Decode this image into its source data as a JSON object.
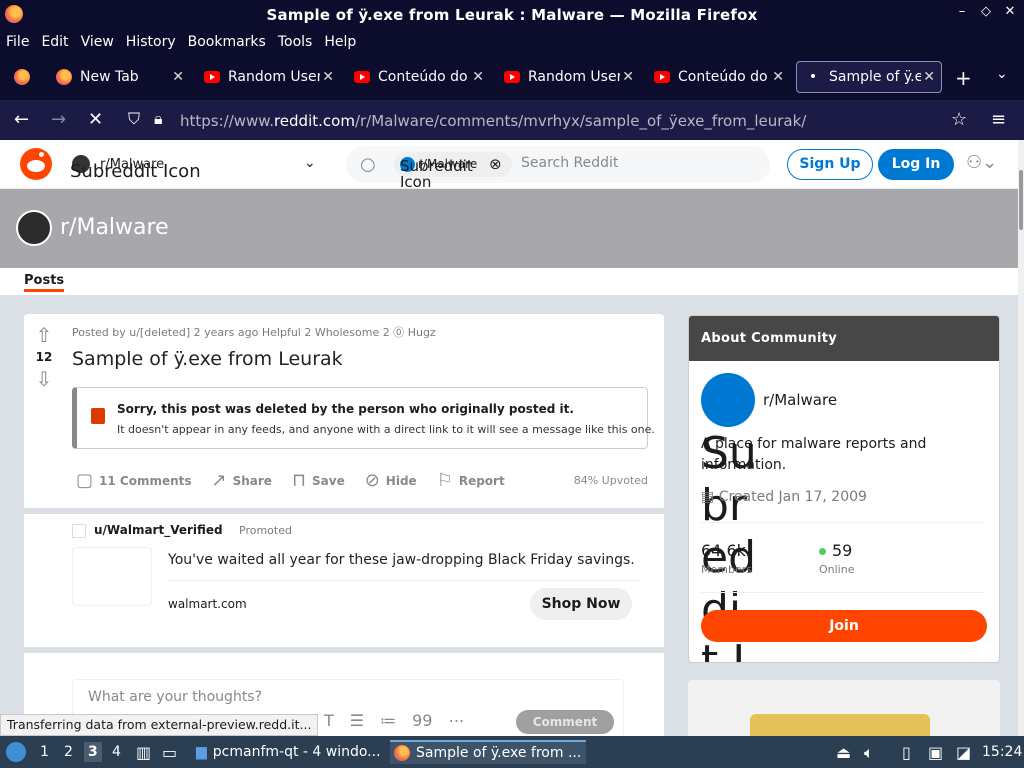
{
  "window": {
    "title": "Sample of ÿ.exe from Leurak : Malware — Mozilla Firefox",
    "controls": [
      "–",
      "◇",
      "✕"
    ]
  },
  "menu": [
    "File",
    "Edit",
    "View",
    "History",
    "Bookmarks",
    "Tools",
    "Help"
  ],
  "tabs": [
    {
      "label": "New Tab",
      "icon": "firefox-icon",
      "active": false
    },
    {
      "label": "Random User",
      "icon": "youtube-icon",
      "active": false
    },
    {
      "label": "Conteúdo do",
      "icon": "youtube-icon",
      "active": false
    },
    {
      "label": "Random User",
      "icon": "youtube-icon",
      "active": false
    },
    {
      "label": "Conteúdo do",
      "icon": "youtube-icon",
      "active": false
    },
    {
      "label": "Sample of ÿ.exe",
      "icon": "loading-dot-icon",
      "active": true
    }
  ],
  "url": {
    "prefix": "https://www.",
    "domain": "reddit.com",
    "path": "/r/Malware/comments/mvrhyx/sample_of_ÿexe_from_leurak/"
  },
  "reddit_header": {
    "community": "r/Malware",
    "community_icon_alt": "Subreddit Icon",
    "search_chip": "r/Malware",
    "search_chip_icon_alt": "Subreddit Icon",
    "search_placeholder": "Search Reddit",
    "signup": "Sign Up",
    "login": "Log In"
  },
  "banner": {
    "name": "r/Malware",
    "tab": "Posts"
  },
  "post": {
    "votes": "12",
    "meta_posted": "Posted by u/[deleted] 2 years ago",
    "award_helpful": "Helpful 2",
    "award_wholesome": "Wholesome 2",
    "award_hugz": "Hugz",
    "title": "Sample of ÿ.exe from Leurak",
    "deleted_title": "Sorry, this post was deleted by the person who originally posted it.",
    "deleted_body": "It doesn't appear in any feeds, and anyone with a direct link to it will see a message like this one.",
    "actions": {
      "comments": "11 Comments",
      "share": "Share",
      "save": "Save",
      "hide": "Hide",
      "report": "Report"
    },
    "upvoted": "84% Upvoted"
  },
  "promoted": {
    "user": "u/Walmart_Verified",
    "tag": "Promoted",
    "text": "You've waited all year for these jaw-dropping Black Friday savings.",
    "domain": "walmart.com",
    "cta": "Shop Now"
  },
  "comment_box": {
    "placeholder": "What are your thoughts?",
    "button": "Comment"
  },
  "status_bar": "Transferring data from external-preview.redd.it...",
  "about": {
    "header": "About Community",
    "name": "r/Malware",
    "icon_alt": "Subreddit Icon",
    "description": "A place for malware reports and information.",
    "created": "Created Jan 17, 2009",
    "members": "64.6k",
    "members_label": "Members",
    "online": "59",
    "online_label": "Online",
    "join": "Join"
  },
  "taskbar": {
    "workspaces": [
      "1",
      "2",
      "3",
      "4"
    ],
    "current_workspace": "3",
    "windows": [
      {
        "label": "pcmanfm-qt - 4 windo..."
      },
      {
        "label": "Sample of ÿ.exe from ..."
      }
    ],
    "clock": "15:24"
  },
  "colors": {
    "reddit_orange": "#ff4500",
    "reddit_blue": "#0079d3",
    "firefox_dark": "#0c0c2c"
  }
}
